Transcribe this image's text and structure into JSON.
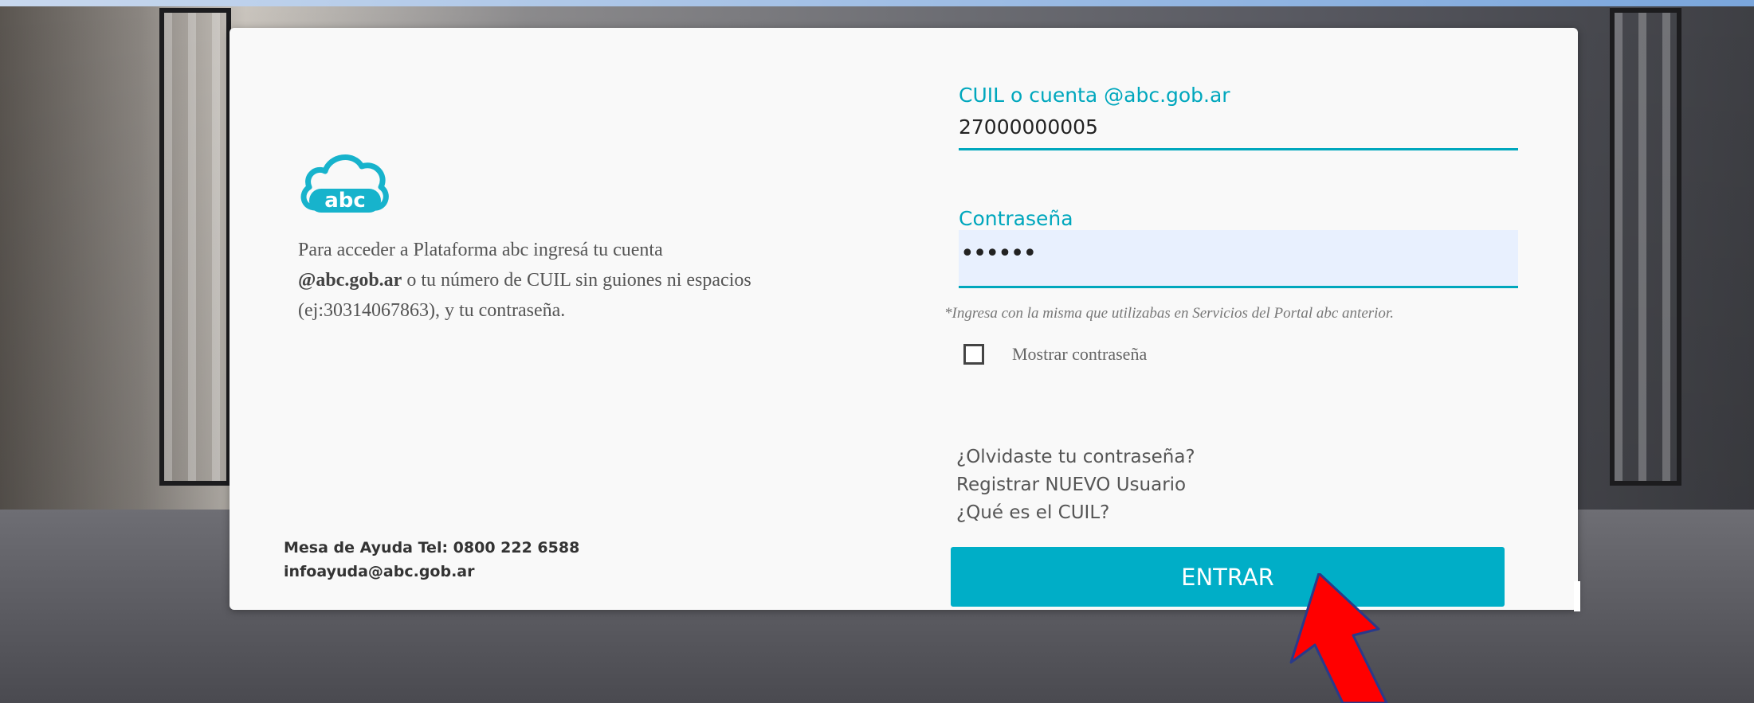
{
  "logo": {
    "text": "abc",
    "icon": "cloud-logo-icon"
  },
  "intro": {
    "line1": "Para acceder a Plataforma abc ingresá tu cuenta",
    "bold": "@abc.gob.ar",
    "line2": " o tu número de CUIL sin guiones ni espacios",
    "line3": "(ej:30314067863), y tu contraseña."
  },
  "help": {
    "phone": "Mesa de Ayuda Tel: 0800 222 6588",
    "email": "infoayuda@abc.gob.ar"
  },
  "login": {
    "user_label": "CUIL o cuenta @abc.gob.ar",
    "user_value": "27000000005",
    "password_label": "Contraseña",
    "password_value": "••••••",
    "hint": "*Ingresa con la misma que utilizabas en Servicios del Portal abc anterior.",
    "show_password_label": "Mostrar contraseña",
    "show_password_checked": false,
    "links": [
      "¿Olvidaste tu contraseña?",
      "Registrar NUEVO Usuario",
      "¿Qué es el CUIL?"
    ],
    "submit_label": "ENTRAR"
  },
  "colors": {
    "accent": "#00aec7",
    "label": "#00a7bd",
    "arrow": "#ff0000"
  }
}
